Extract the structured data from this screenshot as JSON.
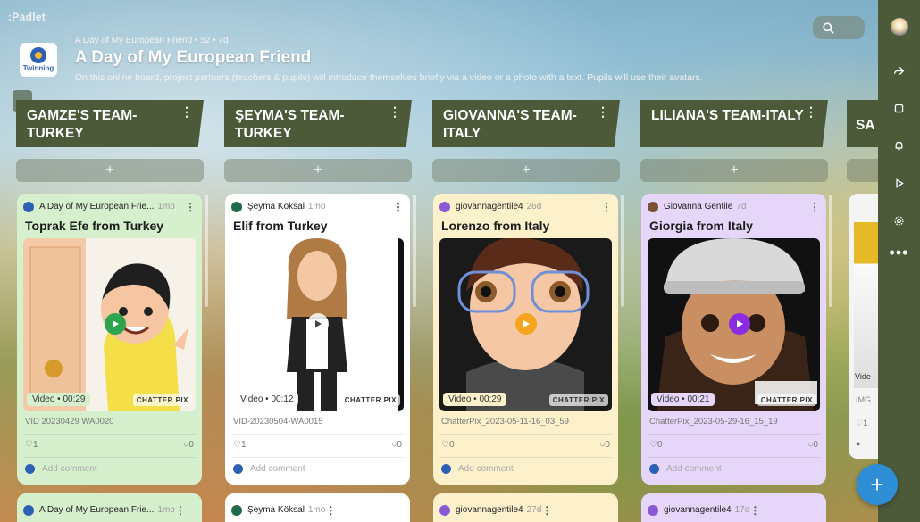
{
  "app": {
    "logo": ":Padlet"
  },
  "header": {
    "meta": "A Day of My European Friend • 52 • 7d",
    "title": "A Day of My European Friend",
    "description": "On this online board, project partners (teachers & pupils) will introduce themselves briefly via a video or a photo with a text. Pupils will use their avatars.",
    "logo_text": "Twinning"
  },
  "columns": [
    {
      "title": "GAMZE'S TEAM-TURKEY",
      "add": "+"
    },
    {
      "title": "ŞEYMA'S TEAM-TURKEY",
      "add": "+"
    },
    {
      "title": "GIOVANNA'S TEAM-ITALY",
      "add": "+"
    },
    {
      "title": "LILIANA'S TEAM-ITALY",
      "add": "+"
    }
  ],
  "partial_column": {
    "title": "SA"
  },
  "cards": [
    {
      "author": "A Day of My European Frie...",
      "time": "1mo",
      "title": "Toprak Efe from Turkey",
      "video": "Video • 00:29",
      "filename": "VID 20230429 WA0020",
      "likes": "♡1",
      "comments": "○0",
      "add_comment": "Add comment",
      "bg": "#d6f0cd",
      "play_color": "#2ea44f"
    },
    {
      "author": "Şeyma Köksal",
      "time": "1mo",
      "title": "Elif from Turkey",
      "video": "Video • 00:12",
      "filename": "VID-20230504-WA0015",
      "likes": "♡1",
      "comments": "○0",
      "add_comment": "Add comment",
      "bg": "#ffffff",
      "play_color": "#444444"
    },
    {
      "author": "giovannagentile4",
      "time": "26d",
      "title": "Lorenzo from Italy",
      "video": "Video • 00:29",
      "filename": "ChatterPix_2023-05-11-16_03_59",
      "likes": "♡0",
      "comments": "○0",
      "add_comment": "Add comment",
      "bg": "#fdf1cc",
      "play_color": "#f4a51c"
    },
    {
      "author": "Giovanna Gentile",
      "time": "7d",
      "title": "Giorgia from Italy",
      "video": "Video • 00:21",
      "filename": "ChatterPix_2023-05-29-16_15_19",
      "likes": "♡0",
      "comments": "○0",
      "add_comment": "Add comment",
      "bg": "#e6d6fa",
      "play_color": "#8a2be2"
    }
  ],
  "partial_card": {
    "video": "Vide",
    "img": "IMG",
    "likes": "♡1"
  },
  "next_cards": [
    {
      "author": "A Day of My European Frie...",
      "time": "1mo"
    },
    {
      "author": "Şeyma Köksal",
      "time": "1mo"
    },
    {
      "author": "giovannagentile4",
      "time": "27d"
    },
    {
      "author": "giovannagentile4",
      "time": "17d"
    }
  ],
  "chatterpix": "CHATTER PIX",
  "fab_label": "+",
  "colors": {
    "column_header": "#4d5a3a",
    "rail": "#4d5a3a",
    "fab": "#2d8ed6"
  }
}
